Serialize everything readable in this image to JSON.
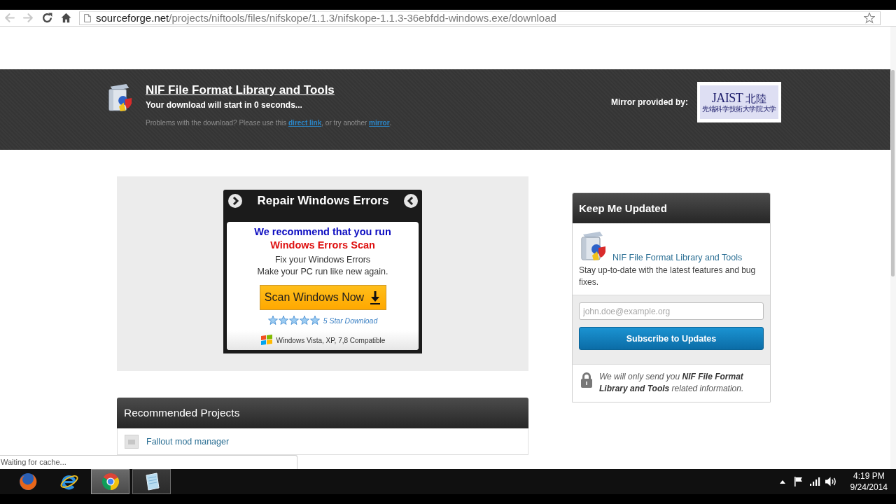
{
  "browser": {
    "nav_buttons": [
      {
        "kind": "back",
        "disabled": true
      },
      {
        "kind": "forward",
        "disabled": true
      },
      {
        "kind": "reload",
        "disabled": false
      },
      {
        "kind": "home",
        "disabled": false
      }
    ],
    "address": {
      "host": "sourceforge.net",
      "path": "/projects/niftools/files/nifskope/1.1.3/nifskope-1.1.3-36ebfdd-windows.exe/download"
    }
  },
  "download_header": {
    "title": "NIF File Format Library and Tools",
    "countdown": "Your download will start in 0 seconds...",
    "help_text": [
      {
        "kind": "text",
        "text": "Problems with the download? Please use this "
      },
      {
        "kind": "link",
        "text": "direct link"
      },
      {
        "kind": "text",
        "text": ", or try another "
      },
      {
        "kind": "link",
        "text": "mirror"
      },
      {
        "kind": "text",
        "text": "."
      }
    ],
    "mirror_label": "Mirror provided by:",
    "mirror_logo": {
      "mark": "JAIST",
      "mark_cjk": "北陸",
      "subtitle": "先端科学技術大学院大学"
    }
  },
  "ad": {
    "title": "Repair Windows Errors",
    "headline": "We recommend that you run",
    "headline_highlight": "Windows Errors Scan",
    "lines": [
      "Fix your Windows Errors",
      "Make your PC run like new again."
    ],
    "button": "Scan Windows Now",
    "stars": 5,
    "rating_label": "5 Star Download",
    "compatibility": "Windows Vista, XP, 7,8 Compatible"
  },
  "updates": {
    "title": "Keep Me Updated",
    "project_link": "NIF File Format Library and Tools",
    "description": "Stay up-to-date with the latest features and bug fixes.",
    "email": {
      "placeholder": "john.doe@example.org"
    },
    "button": "Subscribe to Updates",
    "privacy_note": "We will only send you **NIF File Format Library and Tools** related information."
  },
  "recommended": {
    "title": "Recommended Projects",
    "items": [
      {
        "name": "Fallout mod manager"
      }
    ]
  },
  "status_bubble": "Waiting for cache...",
  "taskbar": {
    "apps": [
      {
        "kind": "firefox",
        "selected": false,
        "running": false
      },
      {
        "kind": "ie",
        "selected": false,
        "running": false
      },
      {
        "kind": "chrome",
        "selected": true,
        "running": true
      },
      {
        "kind": "notepad",
        "selected": false,
        "running": true
      }
    ],
    "tray_icons": [
      {
        "kind": "overflow"
      },
      {
        "kind": "flag"
      },
      {
        "kind": "signal"
      },
      {
        "kind": "volume"
      }
    ],
    "time": "4:19 PM",
    "date": "9/24/2014"
  }
}
